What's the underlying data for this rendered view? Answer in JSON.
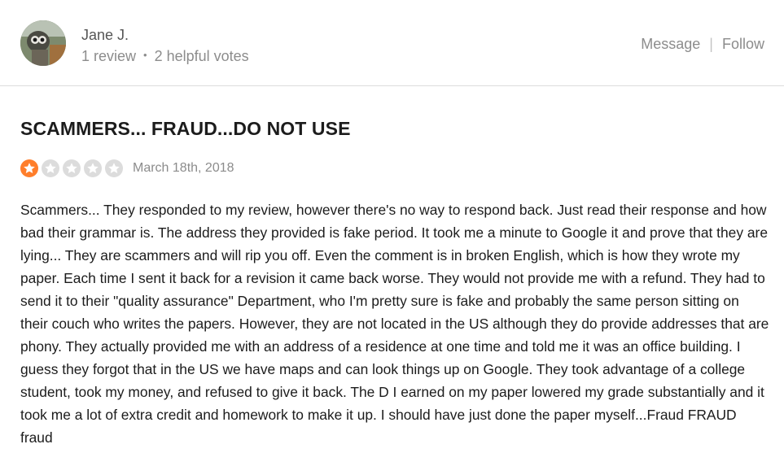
{
  "user": {
    "name": "Jane J.",
    "reviews": "1 review",
    "helpful_votes": "2 helpful votes",
    "separator_dot": "•"
  },
  "actions": {
    "message_label": "Message",
    "separator": "|",
    "follow_label": "Follow"
  },
  "review": {
    "title": "SCAMMERS... FRAUD...DO NOT USE",
    "rating": 1,
    "rating_max": 5,
    "rating_color": "#ff7e2b",
    "date": "March 18th, 2018",
    "body": "Scammers... They responded to my review, however there's no way to respond back. Just read their response and how bad their grammar is. The address they provided is fake period. It took me a minute to Google it and prove that they are lying... They are scammers and will rip you off. Even the comment is in broken English, which is how they wrote my paper. Each time I sent it back for a revision it came back worse. They would not provide me with a refund. They had to send it to their \"quality assurance\" Department, who I'm pretty sure is fake and probably the same person sitting on their couch who writes the papers. However, they are not located in the US although they do provide addresses that are phony. They actually provided me with an address of a residence at one time and told me it was an office building. I guess they forgot that in the US we have maps and can look things up on Google. They took advantage of a college student, took my money, and refused to give it back. The D I earned on my paper lowered my grade substantially and it took me a lot of extra credit and homework to make it up. I should have just done the paper myself...Fraud FRAUD fraud"
  }
}
